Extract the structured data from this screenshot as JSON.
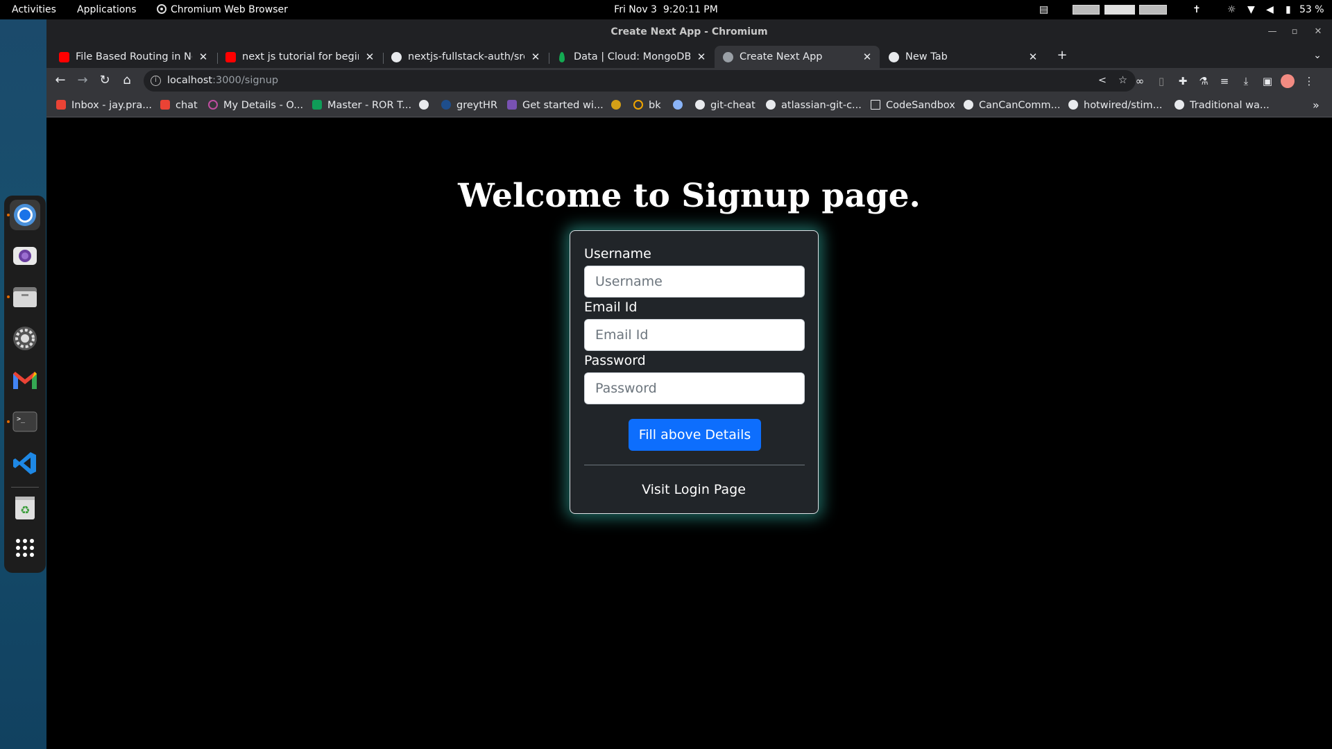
{
  "topbar": {
    "activities": "Activities",
    "applications": "Applications",
    "app_name": "Chromium Web Browser",
    "date": "Fri Nov 3",
    "time": "9:20:11 PM",
    "battery": "53 %"
  },
  "window": {
    "title": "Create Next App - Chromium"
  },
  "tabs": [
    {
      "title": "File Based Routing in Next.js",
      "favicon": "youtube-icon"
    },
    {
      "title": "next js tutorial for beginners",
      "favicon": "youtube-icon"
    },
    {
      "title": "nextjs-fullstack-auth/src/app",
      "favicon": "github-icon"
    },
    {
      "title": "Data | Cloud: MongoDB Cloud",
      "favicon": "mongodb-icon"
    },
    {
      "title": "Create Next App",
      "favicon": "globe-icon",
      "active": true
    },
    {
      "title": "New Tab",
      "favicon": "chrome-icon"
    }
  ],
  "address": {
    "host": "localhost",
    "path": ":3000/signup"
  },
  "bookmarks": [
    {
      "label": "Inbox - jay.pra...",
      "icon": "gmail-icon"
    },
    {
      "label": "chat",
      "icon": "gmail-icon"
    },
    {
      "label": "My Details - O...",
      "icon": "circle-icon"
    },
    {
      "label": "Master - ROR T...",
      "icon": "sheets-icon"
    },
    {
      "label": "",
      "icon": "github-icon"
    },
    {
      "label": "greytHR",
      "icon": "greythr-icon"
    },
    {
      "label": "Get started wi...",
      "icon": "bootstrap-icon"
    },
    {
      "label": "",
      "icon": "bee-icon"
    },
    {
      "label": "bk",
      "icon": "ring-icon"
    },
    {
      "label": "",
      "icon": "sparkle-icon"
    },
    {
      "label": "git-cheat",
      "icon": "github-icon"
    },
    {
      "label": "atlassian-git-c...",
      "icon": "atlassian-icon"
    },
    {
      "label": "CodeSandbox",
      "icon": "codesandbox-icon"
    },
    {
      "label": "CanCanComm...",
      "icon": "github-icon"
    },
    {
      "label": "hotwired/stim...",
      "icon": "github-icon"
    },
    {
      "label": "Traditional wa...",
      "icon": "medium-icon"
    }
  ],
  "signup": {
    "heading": "Welcome to Signup page.",
    "username_label": "Username",
    "username_placeholder": "Username",
    "email_label": "Email Id",
    "email_placeholder": "Email Id",
    "password_label": "Password",
    "password_placeholder": "Password",
    "submit_label": "Fill above Details",
    "login_link": "Visit Login Page"
  },
  "colors": {
    "button": "#0d6efd",
    "card_glow": "#40e0d0",
    "card_bg": "#212529"
  }
}
